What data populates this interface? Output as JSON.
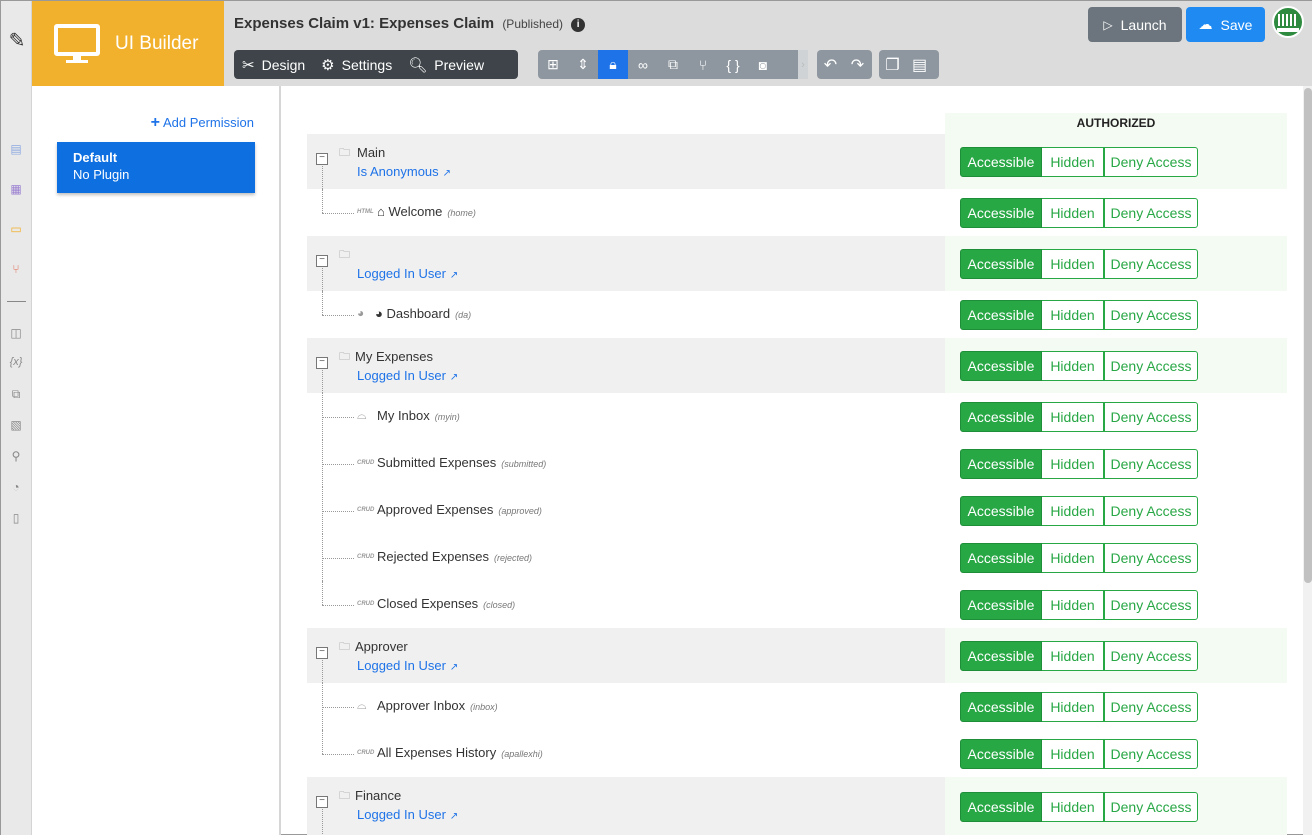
{
  "app": {
    "brand": "UI Builder",
    "title": "Expenses Claim v1: Expenses Claim",
    "status": "(Published)"
  },
  "toolbar": {
    "design": "Design",
    "settings": "Settings",
    "preview": "Preview",
    "launch": "Launch",
    "save": "Save",
    "code_icon": "{ }"
  },
  "permissions": {
    "add_label": "Add Permission",
    "items": [
      {
        "name": "Default",
        "plugin": "No Plugin"
      }
    ]
  },
  "table": {
    "header": "AUTHORIZED",
    "buttons": {
      "accessible": "Accessible",
      "hidden": "Hidden",
      "deny": "Deny Access"
    },
    "rows": [
      {
        "type": "group",
        "title": "Main",
        "link": "Is Anonymous"
      },
      {
        "type": "page",
        "kind": "HTML",
        "icon": "home-icon",
        "title": "Welcome",
        "slug": "(home)"
      },
      {
        "type": "group",
        "title": "",
        "link": "Logged In User"
      },
      {
        "type": "page",
        "kind": "dashboard",
        "icon": "dashboard-icon",
        "title": "Dashboard",
        "slug": "(da)"
      },
      {
        "type": "group",
        "title": "My Expenses",
        "link": "Logged In User"
      },
      {
        "type": "page",
        "kind": "inbox",
        "icon": "inbox-icon",
        "title": "My Inbox",
        "slug": "(myin)"
      },
      {
        "type": "page",
        "kind": "CRUD",
        "title": "Submitted Expenses",
        "slug": "(submitted)"
      },
      {
        "type": "page",
        "kind": "CRUD",
        "title": "Approved Expenses",
        "slug": "(approved)"
      },
      {
        "type": "page",
        "kind": "CRUD",
        "title": "Rejected Expenses",
        "slug": "(rejected)"
      },
      {
        "type": "page",
        "kind": "CRUD",
        "title": "Closed Expenses",
        "slug": "(closed)"
      },
      {
        "type": "group",
        "title": "Approver",
        "link": "Logged In User"
      },
      {
        "type": "page",
        "kind": "inbox",
        "icon": "inbox-icon",
        "title": "Approver Inbox",
        "slug": "(inbox)"
      },
      {
        "type": "page",
        "kind": "CRUD",
        "title": "All Expenses History",
        "slug": "(apallexhi)"
      },
      {
        "type": "group",
        "title": "Finance",
        "link": "Logged In User"
      }
    ]
  },
  "colors": {
    "brand": "#f2b12d",
    "accent": "#1f73e8",
    "accessible": "#28a745",
    "topbar": "#dcdcdc"
  }
}
